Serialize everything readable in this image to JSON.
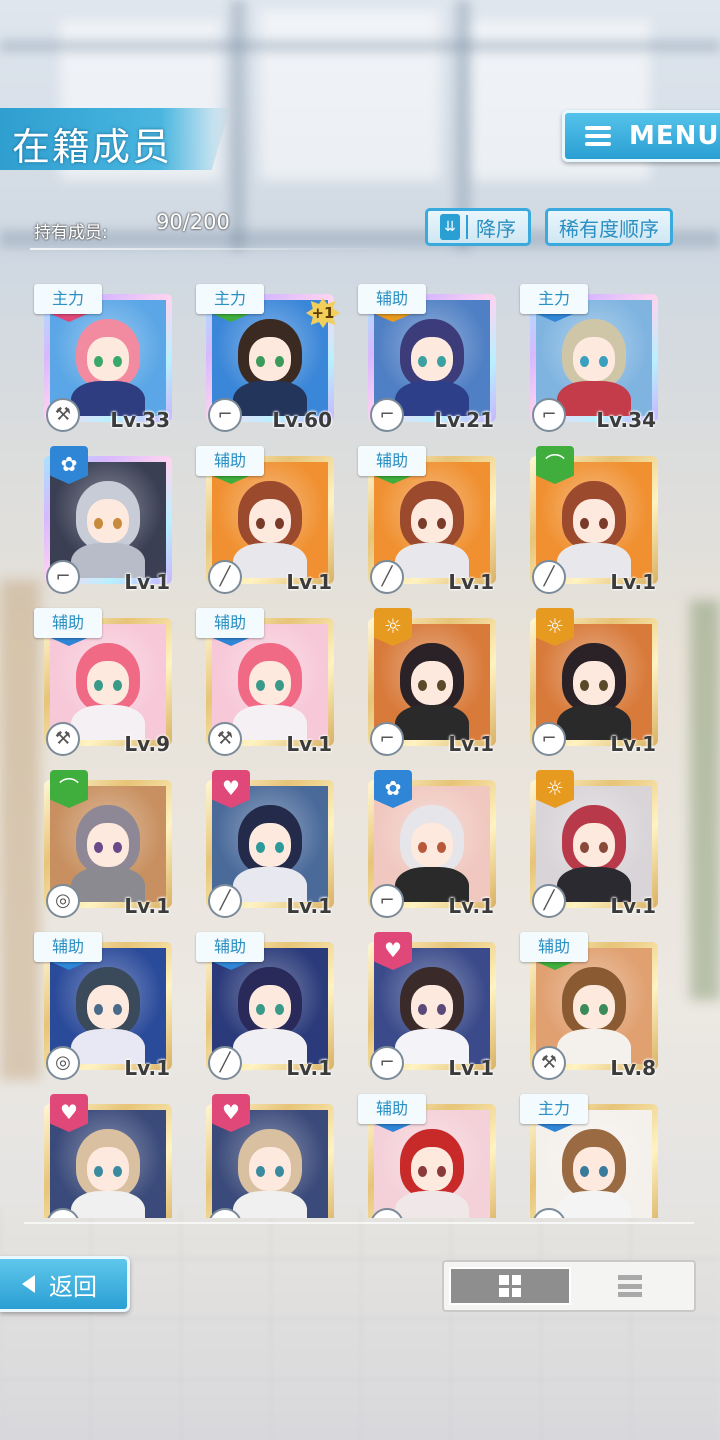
{
  "header": {
    "title": "在籍成员",
    "menu_label": "MENU"
  },
  "members": {
    "label": "持有成员:",
    "count": "90/200"
  },
  "sort": {
    "order_label": "降序",
    "order_icon": "chevron-down-double-icon",
    "rarity_label": "稀有度顺序"
  },
  "cards": [
    {
      "role": "主力",
      "attribute": "cute",
      "frame": "rainbow",
      "weapon": "hammer",
      "level": "Lv.33",
      "hair": "#f28aa0",
      "eyes": "#3aa86a",
      "outfit": "#2d3d80",
      "bg": "#5aa6e6"
    },
    {
      "role": "主力",
      "attribute": "pure",
      "frame": "rainbow",
      "weapon": "rifle",
      "level": "Lv.60",
      "plus": "+1",
      "hair": "#3b2a22",
      "eyes": "#3c9a5a",
      "outfit": "#23355a",
      "bg": "#3a86d8"
    },
    {
      "role": "辅助",
      "attribute": "pop",
      "frame": "rainbow",
      "weapon": "rifle",
      "level": "Lv.21",
      "hair": "#3d3c7a",
      "eyes": "#3aa0a0",
      "outfit": "#2e3f8a",
      "bg": "#4f7fc4"
    },
    {
      "role": "主力",
      "attribute": "cool",
      "frame": "rainbow",
      "weapon": "rifle",
      "level": "Lv.34",
      "hair": "#cfc6a8",
      "eyes": "#3aa0c0",
      "outfit": "#c43c4a",
      "bg": "#7fb4e0"
    },
    {
      "role": "",
      "attribute": "cool",
      "frame": "rainbow",
      "weapon": "rifle",
      "level": "Lv.1",
      "hair": "#c8ccd6",
      "eyes": "#c88a3c",
      "outfit": "#b8bcc8",
      "bg": "#3a3f54"
    },
    {
      "role": "辅助",
      "attribute": "pure",
      "frame": "gold",
      "weapon": "sniper",
      "level": "Lv.1",
      "hair": "#9c4a2e",
      "eyes": "#7a3a2a",
      "outfit": "#e8e8ec",
      "bg": "#f09030"
    },
    {
      "role": "辅助",
      "attribute": "pure",
      "frame": "gold",
      "weapon": "sniper",
      "level": "Lv.1",
      "hair": "#9c4a2e",
      "eyes": "#7a3a2a",
      "outfit": "#e8e8ec",
      "bg": "#f09030"
    },
    {
      "role": "",
      "attribute": "pure",
      "frame": "gold",
      "weapon": "sniper",
      "level": "Lv.1",
      "hair": "#9c4a2e",
      "eyes": "#7a3a2a",
      "outfit": "#e8e8ec",
      "bg": "#f09030"
    },
    {
      "role": "辅助",
      "attribute": "cool",
      "frame": "gold",
      "weapon": "hammer",
      "level": "Lv.9",
      "hair": "#f06a86",
      "eyes": "#3a9a8a",
      "outfit": "#f4f0f4",
      "bg": "#f7c8d8"
    },
    {
      "role": "辅助",
      "attribute": "cool",
      "frame": "gold",
      "weapon": "hammer",
      "level": "Lv.1",
      "hair": "#f06a86",
      "eyes": "#3a9a8a",
      "outfit": "#f4f0f4",
      "bg": "#f7c8d8"
    },
    {
      "role": "",
      "attribute": "pop",
      "frame": "gold",
      "weapon": "rifle",
      "level": "Lv.1",
      "hair": "#2a2226",
      "eyes": "#5a4a2a",
      "outfit": "#2a2a2a",
      "bg": "#d87a3a"
    },
    {
      "role": "",
      "attribute": "pop",
      "frame": "gold",
      "weapon": "rifle",
      "level": "Lv.1",
      "hair": "#2a2226",
      "eyes": "#5a4a2a",
      "outfit": "#2a2a2a",
      "bg": "#d87a3a"
    },
    {
      "role": "",
      "attribute": "pure",
      "frame": "gold",
      "weapon": "shield",
      "level": "Lv.1",
      "hair": "#8e8896",
      "eyes": "#6a4a8a",
      "outfit": "#8a8a90",
      "bg": "#c89060"
    },
    {
      "role": "",
      "attribute": "cute",
      "frame": "gold",
      "weapon": "sniper",
      "level": "Lv.1",
      "hair": "#232a4a",
      "eyes": "#2a9a9a",
      "outfit": "#e8e8f0",
      "bg": "#4a6a9a"
    },
    {
      "role": "",
      "attribute": "cool",
      "frame": "gold",
      "weapon": "rifle",
      "level": "Lv.1",
      "hair": "#e6e6ea",
      "eyes": "#b85a3a",
      "outfit": "#2a2a2a",
      "bg": "#f0c8c0"
    },
    {
      "role": "",
      "attribute": "pop",
      "frame": "gold",
      "weapon": "sniper",
      "level": "Lv.1",
      "hair": "#b83a4a",
      "eyes": "#8a4a3a",
      "outfit": "#2a2a30",
      "bg": "#d8d4d8"
    },
    {
      "role": "辅助",
      "attribute": "cool",
      "frame": "gold",
      "weapon": "shield",
      "level": "Lv.1",
      "hair": "#3a4a5a",
      "eyes": "#4a6a8a",
      "outfit": "#e8e8f4",
      "bg": "#2a4a9a"
    },
    {
      "role": "辅助",
      "attribute": "cool",
      "frame": "gold",
      "weapon": "sniper",
      "level": "Lv.1",
      "hair": "#2a2a5a",
      "eyes": "#3a9a8a",
      "outfit": "#f0f0f4",
      "bg": "#2a3a7a"
    },
    {
      "role": "",
      "attribute": "cute",
      "frame": "gold",
      "weapon": "rifle",
      "level": "Lv.1",
      "hair": "#3a2a2a",
      "eyes": "#5a4a7a",
      "outfit": "#f4f4f8",
      "bg": "#3a4a8a"
    },
    {
      "role": "辅助",
      "attribute": "pure",
      "frame": "gold",
      "weapon": "hammer",
      "level": "Lv.8",
      "hair": "#8a5a32",
      "eyes": "#3a8a5a",
      "outfit": "#f4f0ec",
      "bg": "#e0a070"
    },
    {
      "role": "",
      "attribute": "cute",
      "frame": "gold",
      "weapon": "rifle",
      "level": "",
      "hair": "#d8c0a0",
      "eyes": "#3a8aa0",
      "outfit": "#f0f0f0",
      "bg": "#3a4a7a"
    },
    {
      "role": "",
      "attribute": "cute",
      "frame": "gold",
      "weapon": "rifle",
      "level": "",
      "hair": "#d8c0a0",
      "eyes": "#3a8aa0",
      "outfit": "#f0f0f0",
      "bg": "#3a4a7a"
    },
    {
      "role": "辅助",
      "attribute": "cool",
      "frame": "gold",
      "weapon": "rifle",
      "level": "",
      "locked": true,
      "hair": "#c82a2a",
      "eyes": "#8a3a3a",
      "outfit": "#f0e8e8",
      "bg": "#f4d0d8"
    },
    {
      "role": "主力",
      "attribute": "cool",
      "frame": "gold",
      "weapon": "rifle",
      "level": "",
      "hair": "#9a6a42",
      "eyes": "#3a7a9a",
      "outfit": "#f4f4f4",
      "bg": "#f4f0ec"
    }
  ],
  "footer": {
    "back_label": "返回",
    "view_grid_icon": "grid-view-icon",
    "view_list_icon": "list-view-icon",
    "active_view": "grid"
  },
  "colors": {
    "accent": "#2a9fd3",
    "cute": "#e0487a",
    "cool": "#2f86d6",
    "pop": "#e79a20",
    "pure": "#3fae3c"
  }
}
